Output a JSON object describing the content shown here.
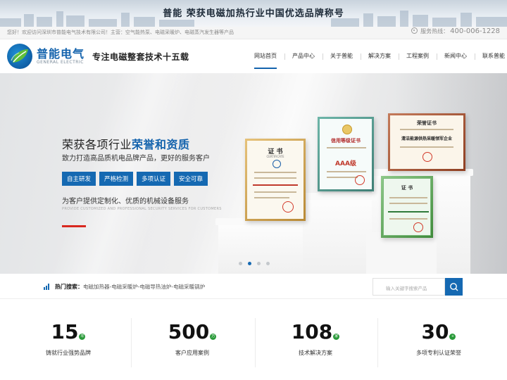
{
  "topbar": {
    "headline": "普能 荣获电磁加热行业中国优选品牌称号"
  },
  "infobar": {
    "welcome": "您好！欢迎访问深圳市普能电气技术有限公司！主营：空气能热泵、电磁采暖炉、电磁蒸汽发生器等产品",
    "hotline_label": "服务热线：",
    "hotline_number": "400-006-1228",
    "icon": "phone-icon"
  },
  "header": {
    "logo_cn": "普能电气",
    "logo_en": "GENERAL ELECTRIC",
    "slogan": "专注电磁整套技术十五载",
    "brand_color": "#1463ad",
    "nav": [
      {
        "label": "网站首页",
        "active": true
      },
      {
        "label": "产品中心"
      },
      {
        "label": "关于普能"
      },
      {
        "label": "解决方案"
      },
      {
        "label": "工程案例"
      },
      {
        "label": "新闻中心"
      },
      {
        "label": "联系普能"
      }
    ]
  },
  "hero": {
    "title_prefix": "荣获各项行业",
    "title_highlight": "荣誉和资质",
    "subtitle": "致力打造高品质机电品牌产品，更好的服务客户",
    "tags": [
      "自主研发",
      "严格检测",
      "多项认证",
      "安全可靠"
    ],
    "text": "为客户提供定制化、优质的机械设备服务",
    "text_en": "PROVIDE CUSTOMIZED AND PROFESSIONAL SECURITY SERVICES FOR CUSTOMERS",
    "accent_color": "#d8281f",
    "certificates": [
      {
        "title": "证 书",
        "subtitle": "CERTIFICATE"
      },
      {
        "title": "信用等级证书",
        "grade": "AAA级"
      },
      {
        "title": "荣誉证书",
        "line": "清洁能源供热采暖领军企业"
      },
      {
        "title": "证 书"
      }
    ],
    "carousel": {
      "count": 4,
      "active": 1
    }
  },
  "search": {
    "hot_label": "热门搜索：",
    "hot_links": "电磁加热器-电磁采暖炉-电磁导热油炉-电磁采暖锅炉",
    "placeholder": "输入关键字搜索产品",
    "icon": "search-icon"
  },
  "stats": [
    {
      "value": "15",
      "unit": "年",
      "label": "铸就行业强势品牌"
    },
    {
      "value": "500",
      "unit": "万",
      "label": "客户应用案例"
    },
    {
      "value": "108",
      "unit": "家",
      "label": "技术解决方案"
    },
    {
      "value": "30",
      "unit": "+",
      "label": "多项专利认证荣誉"
    }
  ]
}
